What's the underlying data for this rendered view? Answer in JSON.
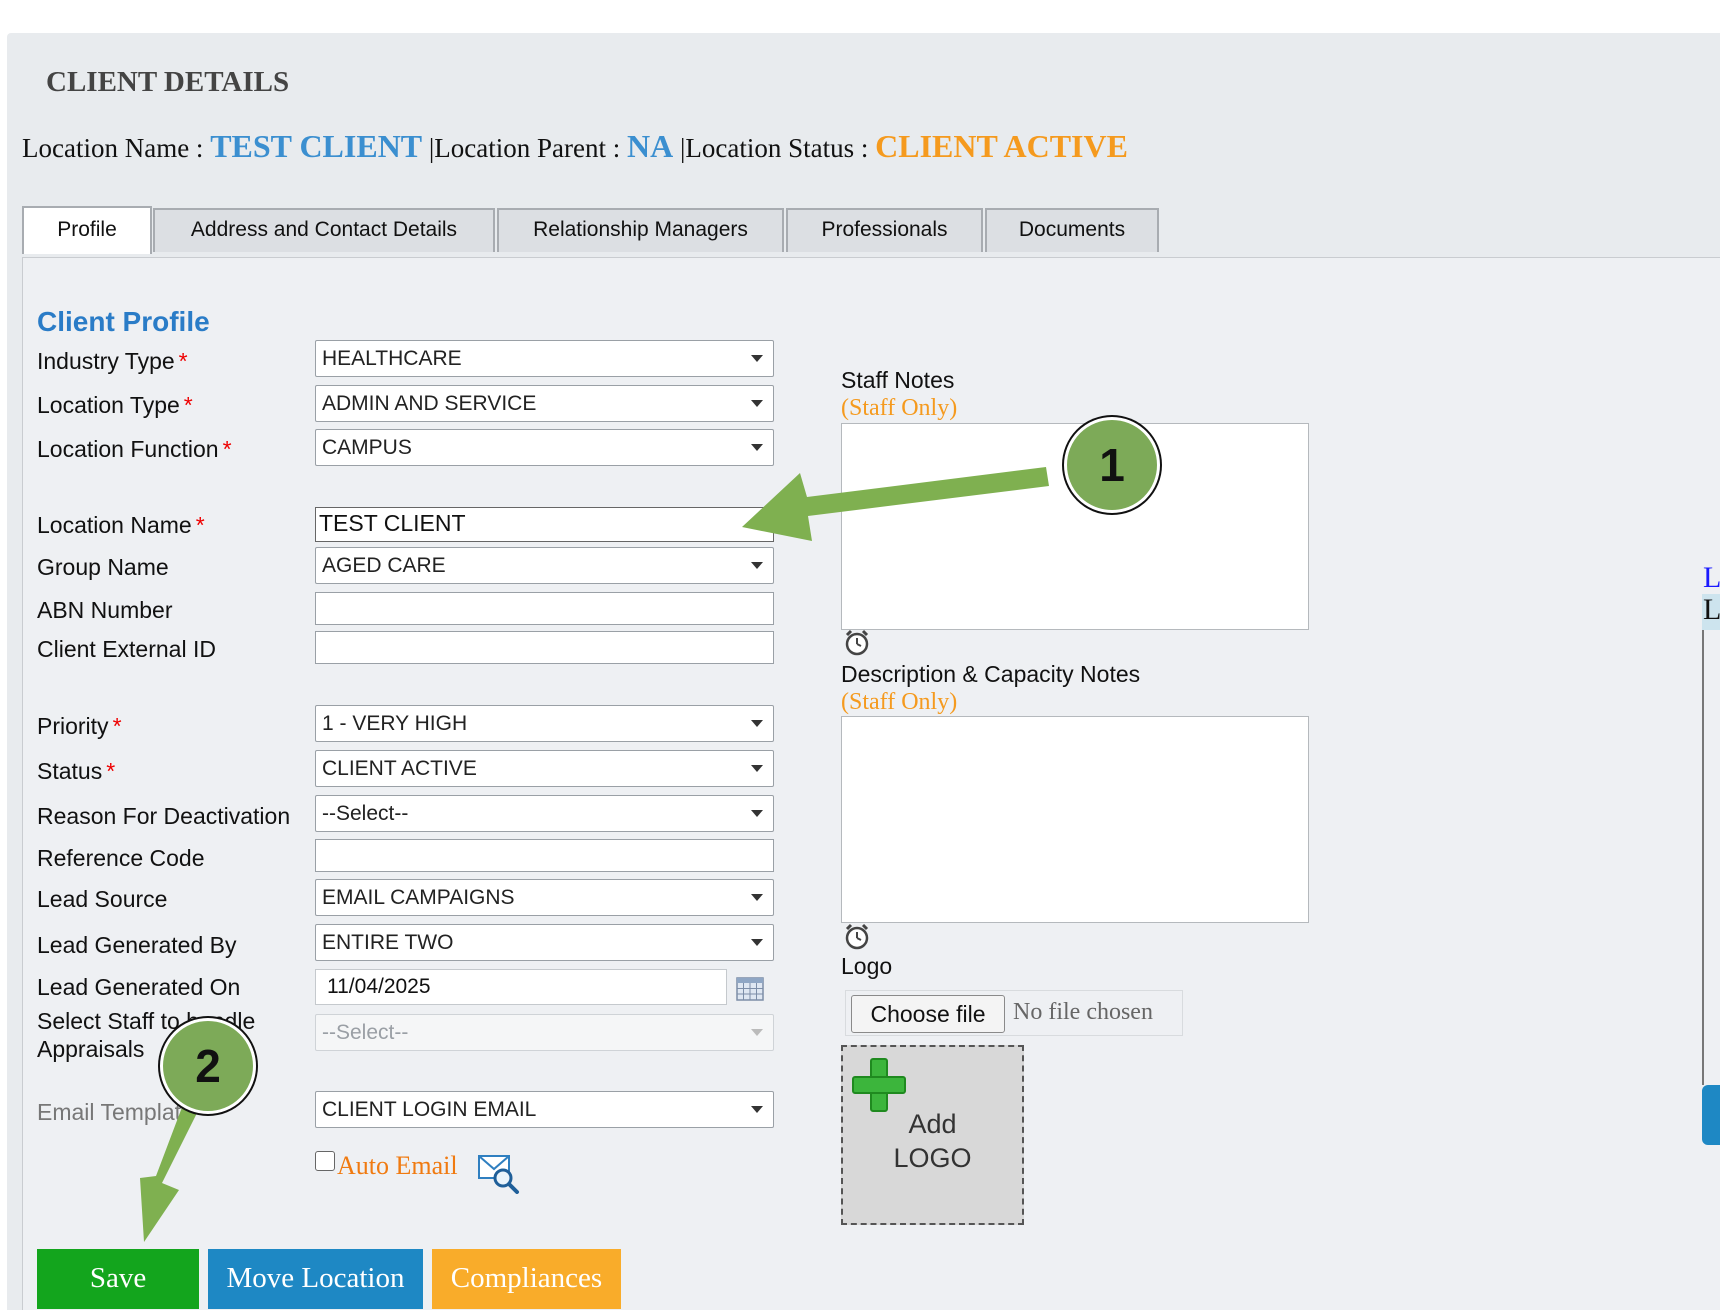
{
  "header": {
    "title": "CLIENT DETAILS",
    "location_name_label": "Location Name :",
    "location_name": "TEST CLIENT",
    "sep1": "|",
    "location_parent_label": "Location Parent :",
    "location_parent": "NA",
    "sep2": "|",
    "location_status_label": "Location Status :",
    "location_status": "CLIENT ACTIVE"
  },
  "tabs": [
    {
      "label": "Profile",
      "active": true
    },
    {
      "label": "Address and Contact Details"
    },
    {
      "label": "Relationship Managers"
    },
    {
      "label": "Professionals"
    },
    {
      "label": "Documents"
    }
  ],
  "profile": {
    "section_title": "Client Profile",
    "required_mark": "*",
    "industry_type": {
      "label": "Industry Type",
      "value": "HEALTHCARE"
    },
    "location_type": {
      "label": "Location Type",
      "value": "ADMIN AND SERVICE"
    },
    "location_function": {
      "label": "Location Function",
      "value": "CAMPUS"
    },
    "location_name": {
      "label": "Location Name",
      "value": "TEST CLIENT"
    },
    "group_name": {
      "label": "Group Name",
      "value": "AGED CARE"
    },
    "abn_number": {
      "label": "ABN Number",
      "value": ""
    },
    "client_external_id": {
      "label": "Client External ID",
      "value": ""
    },
    "priority": {
      "label": "Priority",
      "value": "1 - VERY HIGH"
    },
    "status": {
      "label": "Status",
      "value": "CLIENT ACTIVE"
    },
    "reason_for_deactivation": {
      "label": "Reason For Deactivation",
      "value": "--Select--"
    },
    "reference_code": {
      "label": "Reference Code",
      "value": ""
    },
    "lead_source": {
      "label": "Lead Source",
      "value": "EMAIL CAMPAIGNS"
    },
    "lead_generated_by": {
      "label": "Lead Generated By",
      "value": "ENTIRE TWO"
    },
    "lead_generated_on": {
      "label": "Lead Generated On",
      "value": "11/04/2025"
    },
    "select_staff": {
      "label_line1": "Select Staff to handle",
      "label_line2": "Appraisals",
      "value": "--Select--"
    },
    "email_template": {
      "label": "Email Template",
      "value": "CLIENT LOGIN EMAIL"
    },
    "auto_email": {
      "label": "Auto Email",
      "checked": false
    }
  },
  "notes": {
    "staff_notes_label": "Staff Notes",
    "staff_only_1": "(Staff Only)",
    "description_label": "Description & Capacity Notes",
    "staff_only_2": "(Staff Only)",
    "logo_label": "Logo",
    "choose_file": "Choose file",
    "no_file": "No file chosen",
    "add_logo_line1": "Add",
    "add_logo_line2": "LOGO"
  },
  "buttons": {
    "save": "Save",
    "move_location": "Move Location",
    "compliances": "Compliances"
  },
  "annotations": {
    "callout_1": "1",
    "callout_2": "2"
  },
  "clipped_right_edge": [
    "L",
    "L"
  ],
  "colors": {
    "accent_blue": "#3b8fd0",
    "status_orange": "#f59a1e",
    "save_green": "#13a51d",
    "move_blue": "#1e88c4",
    "compliances_orange": "#f9ac2a",
    "callout_green": "#7daa58"
  },
  "icons": [
    "clock-icon",
    "calendar-icon",
    "email-preview-icon",
    "plus-icon",
    "dropdown-caret-icon"
  ]
}
